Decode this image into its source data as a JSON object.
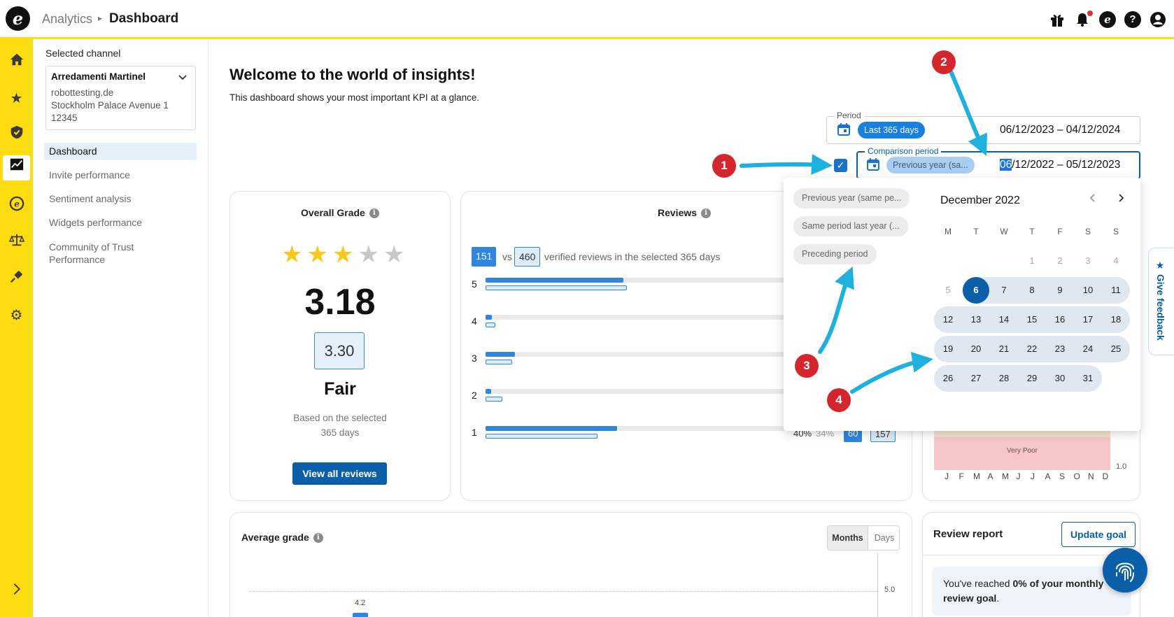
{
  "header": {
    "breadcrumb_parent": "Analytics",
    "breadcrumb_sep": "▸",
    "breadcrumb_current": "Dashboard",
    "logo_letter": "e",
    "icons": [
      "gift-icon",
      "bell-icon",
      "trusted-logo-icon",
      "help-icon",
      "account-icon"
    ]
  },
  "sidebar": {
    "icons": [
      "home-icon",
      "star-icon",
      "shield-icon",
      "analytics-icon",
      "trusted-icon",
      "scales-icon",
      "plug-icon",
      "gear-icon",
      "expand-icon"
    ]
  },
  "channel": {
    "section_title": "Selected channel",
    "name": "Arredamenti Martinel",
    "domain": "robottesting.de",
    "address": "Stockholm Palace Avenue 1",
    "zip": "12345"
  },
  "nav": {
    "items": [
      "Dashboard",
      "Invite performance",
      "Sentiment analysis",
      "Widgets performance",
      "Community of Trust Performance"
    ]
  },
  "main": {
    "title": "Welcome to the world of insights!",
    "subtitle": "This dashboard shows your most important KPI at a glance."
  },
  "period": {
    "label": "Period",
    "chip": "Last 365 days",
    "range": "06/12/2023 – 04/12/2024"
  },
  "comparison": {
    "label": "Comparison period",
    "chip": "Previous year (sa...",
    "range_highlight": "06",
    "range_rest": "/12/2022 – 05/12/2023",
    "checked": true
  },
  "overall_grade": {
    "title": "Overall Grade",
    "stars_filled": 3,
    "stars_total": 5,
    "grade": "3.18",
    "comparison_grade": "3.30",
    "label": "Fair",
    "basis": "Based on the selected 365 days",
    "button": "View all reviews"
  },
  "reviews": {
    "title": "Reviews",
    "count_current": "151",
    "vs": "vs",
    "count_compare": "460",
    "text": "verified reviews in the selected 365 days",
    "rows": [
      {
        "label": "5",
        "current": 0.42,
        "compare": 0.43
      },
      {
        "label": "4",
        "current": 0.02,
        "compare": 0.03
      },
      {
        "label": "3",
        "current": 0.09,
        "compare": 0.08
      },
      {
        "label": "2",
        "current": 0.01,
        "compare": 0.05
      },
      {
        "label": "1",
        "current": 0.4,
        "compare": 0.34
      }
    ],
    "row1_pct": "40%",
    "row1_pct_compare": "34%",
    "row1_count": "60",
    "row1_count_compare": "157"
  },
  "date_popup": {
    "presets": [
      "Previous year (same pe...",
      "Same period last year (...",
      "Preceding period"
    ],
    "month": "December 2022",
    "prev": "‹",
    "next": "›",
    "weekdays": [
      "M",
      "T",
      "W",
      "T",
      "F",
      "S",
      "S"
    ],
    "rows": [
      [
        "",
        "",
        "",
        "1",
        "2",
        "3",
        "4"
      ],
      [
        "5",
        "6",
        "7",
        "8",
        "9",
        "10",
        "11"
      ],
      [
        "12",
        "13",
        "14",
        "15",
        "16",
        "17",
        "18"
      ],
      [
        "19",
        "20",
        "21",
        "22",
        "23",
        "24",
        "25"
      ],
      [
        "26",
        "27",
        "28",
        "29",
        "30",
        "31",
        ""
      ]
    ],
    "selected": "6"
  },
  "grade_chart": {
    "band_label": "Very Poor",
    "ymin_label": "1.0",
    "months": [
      "J",
      "F",
      "M",
      "A",
      "M",
      "J",
      "J",
      "A",
      "S",
      "O",
      "N",
      "D"
    ]
  },
  "average_grade": {
    "title": "Average grade",
    "toggle_months": "Months",
    "toggle_days": "Days",
    "ymax_label": "5.0",
    "first_value": "4.2"
  },
  "review_report": {
    "title": "Review report",
    "button": "Update goal",
    "goal_prefix": "You've reached ",
    "goal_bold": "0% of your monthly review goal",
    "goal_suffix": "."
  },
  "feedback": {
    "label": "★ Give feedback"
  },
  "annotations": [
    "1",
    "2",
    "3",
    "4"
  ],
  "colors": {
    "brand_yellow": "#ffdc0f",
    "primary_blue": "#0b5fa9",
    "bar_blue": "#2f86e0",
    "arrow_cyan": "#1fb1de",
    "marker_red": "#d6262d"
  }
}
